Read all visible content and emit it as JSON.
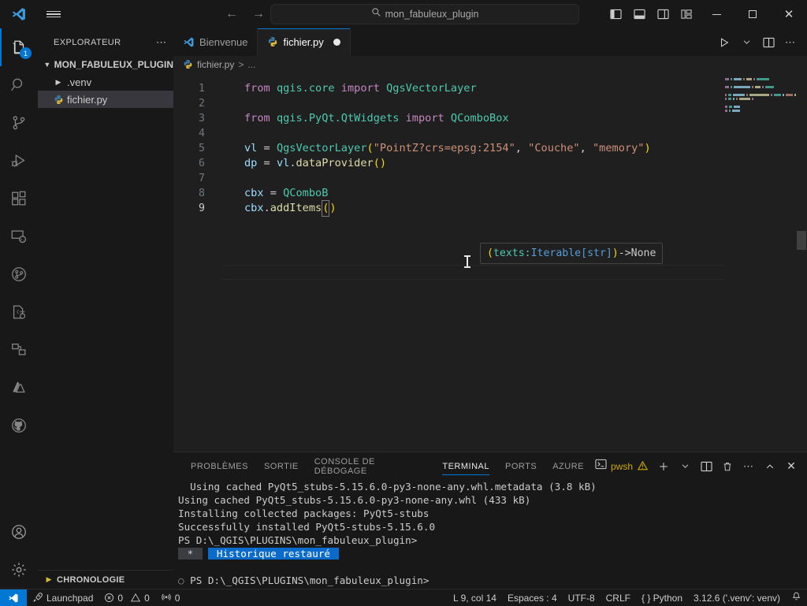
{
  "titlebar": {
    "logo_icon": "vscode-logo-icon",
    "menu_icon": "hamburger-menu-icon",
    "back_icon": "arrow-left-icon",
    "forward_icon": "arrow-right-icon",
    "search_icon": "search-icon",
    "search_value": "mon_fabuleux_plugin",
    "layout_primary_icon": "toggle-primary-sidebar-icon",
    "layout_panel_icon": "toggle-panel-icon",
    "layout_secondary_icon": "toggle-secondary-sidebar-icon",
    "layout_customize_icon": "customize-layout-icon",
    "minimize_label": "minimize-icon",
    "maximize_label": "maximize-icon",
    "close_label": "close-icon"
  },
  "activitybar": {
    "items": [
      {
        "name": "explorer",
        "icon": "files-icon",
        "badge": "1",
        "active": true
      },
      {
        "name": "search",
        "icon": "search-icon",
        "badge": "",
        "active": false
      },
      {
        "name": "source-control",
        "icon": "source-control-icon",
        "badge": "",
        "active": false
      },
      {
        "name": "run-and-debug",
        "icon": "run-debug-icon",
        "badge": "",
        "active": false
      },
      {
        "name": "extensions",
        "icon": "extensions-icon",
        "badge": "",
        "active": false
      },
      {
        "name": "remote-explorer",
        "icon": "remote-explorer-icon",
        "badge": "",
        "active": false
      },
      {
        "name": "testing",
        "icon": "beaker-testing-icon",
        "badge": "",
        "active": false
      },
      {
        "name": "cpp-tools",
        "icon": "cpp-settings-icon",
        "badge": "",
        "active": false
      },
      {
        "name": "docker",
        "icon": "docker-containers-icon",
        "badge": "",
        "active": false
      },
      {
        "name": "azure",
        "icon": "azure-icon",
        "badge": "",
        "active": false
      },
      {
        "name": "github",
        "icon": "github-icon",
        "badge": "",
        "active": false
      }
    ],
    "bottom": [
      {
        "name": "accounts",
        "icon": "account-icon"
      },
      {
        "name": "manage-settings",
        "icon": "gear-icon"
      }
    ]
  },
  "sidebar": {
    "title": "EXPLORATEUR",
    "more_actions_icon": "ellipsis-icon",
    "root": {
      "label": "MON_FABULEUX_PLUGIN",
      "chevron": "chevron-down-icon"
    },
    "items": [
      {
        "label": ".venv",
        "icon": "folder-icon",
        "chevron": "chevron-right-icon",
        "selected": false
      },
      {
        "label": "fichier.py",
        "icon": "python-file-icon",
        "chevron": "",
        "selected": true
      }
    ],
    "footer": {
      "label": "CHRONOLOGIE",
      "chevron": "chevron-right-icon"
    }
  },
  "editor": {
    "tabs": [
      {
        "label": "Bienvenue",
        "icon": "vscode-logo-icon",
        "active": false,
        "dirty": false
      },
      {
        "label": "fichier.py",
        "icon": "python-file-icon",
        "active": true,
        "dirty": true
      }
    ],
    "actions": [
      {
        "name": "run-python-file",
        "icon": "play-icon"
      },
      {
        "name": "run-options-dropdown",
        "icon": "chevron-down-icon"
      },
      {
        "name": "split-editor-right",
        "icon": "split-editor-icon"
      },
      {
        "name": "more-actions",
        "icon": "ellipsis-icon"
      }
    ],
    "breadcrumb": {
      "file_icon": "python-file-icon",
      "file": "fichier.py",
      "separator": ">",
      "tail": "..."
    },
    "lines": [
      {
        "n": "1",
        "tokens": [
          {
            "t": "from",
            "c": "k-kw"
          },
          {
            "t": " ",
            "c": "k-plain"
          },
          {
            "t": "qgis.core",
            "c": "k-mod"
          },
          {
            "t": " ",
            "c": "k-plain"
          },
          {
            "t": "import",
            "c": "k-kw"
          },
          {
            "t": " ",
            "c": "k-plain"
          },
          {
            "t": "QgsVectorLayer",
            "c": "k-mod"
          }
        ]
      },
      {
        "n": "2",
        "tokens": []
      },
      {
        "n": "3",
        "tokens": [
          {
            "t": "from",
            "c": "k-kw"
          },
          {
            "t": " ",
            "c": "k-plain"
          },
          {
            "t": "qgis.PyQt.QtWidgets",
            "c": "k-mod"
          },
          {
            "t": " ",
            "c": "k-plain"
          },
          {
            "t": "import",
            "c": "k-kw"
          },
          {
            "t": " ",
            "c": "k-plain"
          },
          {
            "t": "QComboBox",
            "c": "k-mod"
          }
        ]
      },
      {
        "n": "4",
        "tokens": []
      },
      {
        "n": "5",
        "tokens": [
          {
            "t": "vl",
            "c": "k-var"
          },
          {
            "t": " = ",
            "c": "k-op"
          },
          {
            "t": "QgsVectorLayer",
            "c": "k-mod"
          },
          {
            "t": "(",
            "c": "k-paren"
          },
          {
            "t": "\"PointZ?crs=epsg:2154\"",
            "c": "k-str"
          },
          {
            "t": ", ",
            "c": "k-op"
          },
          {
            "t": "\"Couche\"",
            "c": "k-str"
          },
          {
            "t": ", ",
            "c": "k-op"
          },
          {
            "t": "\"memory\"",
            "c": "k-str"
          },
          {
            "t": ")",
            "c": "k-paren"
          }
        ]
      },
      {
        "n": "6",
        "tokens": [
          {
            "t": "dp",
            "c": "k-var"
          },
          {
            "t": " = ",
            "c": "k-op"
          },
          {
            "t": "vl",
            "c": "k-var"
          },
          {
            "t": ".",
            "c": "k-plain"
          },
          {
            "t": "dataProvider",
            "c": "k-fn"
          },
          {
            "t": "()",
            "c": "k-paren"
          }
        ]
      },
      {
        "n": "7",
        "tokens": []
      },
      {
        "n": "8",
        "tokens": [
          {
            "t": "cbx",
            "c": "k-var"
          },
          {
            "t": " = ",
            "c": "k-op"
          },
          {
            "t": "QComboB",
            "c": "k-mod"
          }
        ]
      },
      {
        "n": "9",
        "tokens": [
          {
            "t": "cbx",
            "c": "k-var"
          },
          {
            "t": ".",
            "c": "k-plain"
          },
          {
            "t": "addItems",
            "c": "k-fn"
          }
        ]
      }
    ],
    "cursor_line": "9",
    "signature_help": {
      "open_paren": "(",
      "param_name": "texts",
      "colon": ": ",
      "param_type": "Iterable[str]",
      "close_paren": ")",
      "arrow": " -> ",
      "return_type": "None"
    },
    "paren_pair": {
      "open": "(",
      "close": ")"
    }
  },
  "panel": {
    "tabs": [
      {
        "label": "PROBLÈMES",
        "active": false
      },
      {
        "label": "SORTIE",
        "active": false
      },
      {
        "label": "CONSOLE DE DÉBOGAGE",
        "active": false
      },
      {
        "label": "TERMINAL",
        "active": true
      },
      {
        "label": "PORTS",
        "active": false
      },
      {
        "label": "AZURE",
        "active": false
      }
    ],
    "shell_icon": "terminal-icon",
    "shell_label": "pwsh",
    "warning_icon": "warning-triangle-icon",
    "actions": [
      {
        "name": "new-terminal",
        "icon": "plus-icon"
      },
      {
        "name": "terminal-profile-dropdown",
        "icon": "chevron-down-icon"
      },
      {
        "name": "split-terminal",
        "icon": "split-terminal-icon"
      },
      {
        "name": "kill-terminal",
        "icon": "trash-icon"
      },
      {
        "name": "panel-more-actions",
        "icon": "ellipsis-icon"
      },
      {
        "name": "maximize-panel",
        "icon": "chevron-up-icon"
      },
      {
        "name": "close-panel",
        "icon": "close-icon"
      }
    ],
    "terminal_lines": [
      {
        "text": "  Using cached PyQt5_stubs-5.15.6.0-py3-none-any.whl.metadata (3.8 kB)",
        "kind": "plain"
      },
      {
        "text": "Using cached PyQt5_stubs-5.15.6.0-py3-none-any.whl (433 kB)",
        "kind": "plain"
      },
      {
        "text": "Installing collected packages: PyQt5-stubs",
        "kind": "plain"
      },
      {
        "text": "Successfully installed PyQt5-stubs-5.15.6.0",
        "kind": "plain"
      },
      {
        "text": "PS D:\\_QGIS\\PLUGINS\\mon_fabuleux_plugin>",
        "kind": "plain"
      },
      {
        "text": "",
        "kind": "history",
        "badge": "*",
        "highlight": "Historique restauré"
      },
      {
        "text": "",
        "kind": "plain"
      },
      {
        "text": "PS D:\\_QGIS\\PLUGINS\\mon_fabuleux_plugin>",
        "kind": "prompt",
        "gutter": "circle-icon"
      }
    ]
  },
  "statusbar": {
    "remote_icon": "remote-window-icon",
    "left": [
      {
        "name": "launchpad",
        "icon": "rocket-icon",
        "label": "Launchpad"
      },
      {
        "name": "problems-errors",
        "icon": "error-circle-icon",
        "label": "0"
      },
      {
        "name": "problems-warnings",
        "icon": "warning-triangle-icon",
        "label": "0"
      },
      {
        "name": "ports-forwarded",
        "icon": "radio-tower-icon",
        "label": "0"
      }
    ],
    "right": [
      {
        "name": "cursor-position",
        "label": "L 9, col 14"
      },
      {
        "name": "indentation",
        "label": "Espaces : 4"
      },
      {
        "name": "encoding",
        "label": "UTF-8"
      },
      {
        "name": "eol",
        "label": "CRLF"
      },
      {
        "name": "language-mode",
        "label": "{ }  Python"
      },
      {
        "name": "python-interpreter",
        "label": "3.12.6 ('.venv': venv)"
      }
    ],
    "notifications_icon": "bell-icon"
  },
  "colors": {
    "accent": "#0078d4",
    "titlebar_bg": "#181818",
    "editor_bg": "#1f1f1f",
    "selection_bg": "#37373d",
    "warning": "#cca700",
    "terminal_highlight": "#0b6bcb"
  }
}
